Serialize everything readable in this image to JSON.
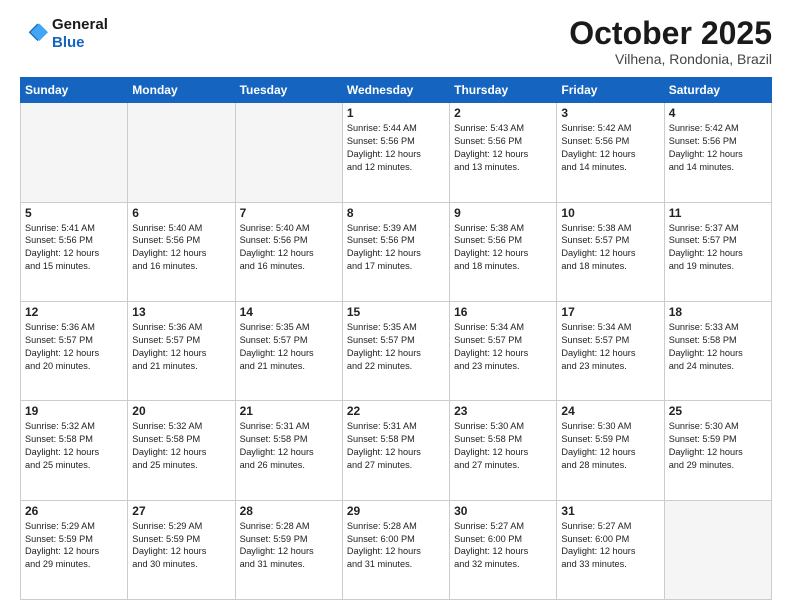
{
  "header": {
    "logo_line1": "General",
    "logo_line2": "Blue",
    "month": "October 2025",
    "location": "Vilhena, Rondonia, Brazil"
  },
  "weekdays": [
    "Sunday",
    "Monday",
    "Tuesday",
    "Wednesday",
    "Thursday",
    "Friday",
    "Saturday"
  ],
  "weeks": [
    [
      {
        "day": "",
        "text": ""
      },
      {
        "day": "",
        "text": ""
      },
      {
        "day": "",
        "text": ""
      },
      {
        "day": "1",
        "text": "Sunrise: 5:44 AM\nSunset: 5:56 PM\nDaylight: 12 hours\nand 12 minutes."
      },
      {
        "day": "2",
        "text": "Sunrise: 5:43 AM\nSunset: 5:56 PM\nDaylight: 12 hours\nand 13 minutes."
      },
      {
        "day": "3",
        "text": "Sunrise: 5:42 AM\nSunset: 5:56 PM\nDaylight: 12 hours\nand 14 minutes."
      },
      {
        "day": "4",
        "text": "Sunrise: 5:42 AM\nSunset: 5:56 PM\nDaylight: 12 hours\nand 14 minutes."
      }
    ],
    [
      {
        "day": "5",
        "text": "Sunrise: 5:41 AM\nSunset: 5:56 PM\nDaylight: 12 hours\nand 15 minutes."
      },
      {
        "day": "6",
        "text": "Sunrise: 5:40 AM\nSunset: 5:56 PM\nDaylight: 12 hours\nand 16 minutes."
      },
      {
        "day": "7",
        "text": "Sunrise: 5:40 AM\nSunset: 5:56 PM\nDaylight: 12 hours\nand 16 minutes."
      },
      {
        "day": "8",
        "text": "Sunrise: 5:39 AM\nSunset: 5:56 PM\nDaylight: 12 hours\nand 17 minutes."
      },
      {
        "day": "9",
        "text": "Sunrise: 5:38 AM\nSunset: 5:56 PM\nDaylight: 12 hours\nand 18 minutes."
      },
      {
        "day": "10",
        "text": "Sunrise: 5:38 AM\nSunset: 5:57 PM\nDaylight: 12 hours\nand 18 minutes."
      },
      {
        "day": "11",
        "text": "Sunrise: 5:37 AM\nSunset: 5:57 PM\nDaylight: 12 hours\nand 19 minutes."
      }
    ],
    [
      {
        "day": "12",
        "text": "Sunrise: 5:36 AM\nSunset: 5:57 PM\nDaylight: 12 hours\nand 20 minutes."
      },
      {
        "day": "13",
        "text": "Sunrise: 5:36 AM\nSunset: 5:57 PM\nDaylight: 12 hours\nand 21 minutes."
      },
      {
        "day": "14",
        "text": "Sunrise: 5:35 AM\nSunset: 5:57 PM\nDaylight: 12 hours\nand 21 minutes."
      },
      {
        "day": "15",
        "text": "Sunrise: 5:35 AM\nSunset: 5:57 PM\nDaylight: 12 hours\nand 22 minutes."
      },
      {
        "day": "16",
        "text": "Sunrise: 5:34 AM\nSunset: 5:57 PM\nDaylight: 12 hours\nand 23 minutes."
      },
      {
        "day": "17",
        "text": "Sunrise: 5:34 AM\nSunset: 5:57 PM\nDaylight: 12 hours\nand 23 minutes."
      },
      {
        "day": "18",
        "text": "Sunrise: 5:33 AM\nSunset: 5:58 PM\nDaylight: 12 hours\nand 24 minutes."
      }
    ],
    [
      {
        "day": "19",
        "text": "Sunrise: 5:32 AM\nSunset: 5:58 PM\nDaylight: 12 hours\nand 25 minutes."
      },
      {
        "day": "20",
        "text": "Sunrise: 5:32 AM\nSunset: 5:58 PM\nDaylight: 12 hours\nand 25 minutes."
      },
      {
        "day": "21",
        "text": "Sunrise: 5:31 AM\nSunset: 5:58 PM\nDaylight: 12 hours\nand 26 minutes."
      },
      {
        "day": "22",
        "text": "Sunrise: 5:31 AM\nSunset: 5:58 PM\nDaylight: 12 hours\nand 27 minutes."
      },
      {
        "day": "23",
        "text": "Sunrise: 5:30 AM\nSunset: 5:58 PM\nDaylight: 12 hours\nand 27 minutes."
      },
      {
        "day": "24",
        "text": "Sunrise: 5:30 AM\nSunset: 5:59 PM\nDaylight: 12 hours\nand 28 minutes."
      },
      {
        "day": "25",
        "text": "Sunrise: 5:30 AM\nSunset: 5:59 PM\nDaylight: 12 hours\nand 29 minutes."
      }
    ],
    [
      {
        "day": "26",
        "text": "Sunrise: 5:29 AM\nSunset: 5:59 PM\nDaylight: 12 hours\nand 29 minutes."
      },
      {
        "day": "27",
        "text": "Sunrise: 5:29 AM\nSunset: 5:59 PM\nDaylight: 12 hours\nand 30 minutes."
      },
      {
        "day": "28",
        "text": "Sunrise: 5:28 AM\nSunset: 5:59 PM\nDaylight: 12 hours\nand 31 minutes."
      },
      {
        "day": "29",
        "text": "Sunrise: 5:28 AM\nSunset: 6:00 PM\nDaylight: 12 hours\nand 31 minutes."
      },
      {
        "day": "30",
        "text": "Sunrise: 5:27 AM\nSunset: 6:00 PM\nDaylight: 12 hours\nand 32 minutes."
      },
      {
        "day": "31",
        "text": "Sunrise: 5:27 AM\nSunset: 6:00 PM\nDaylight: 12 hours\nand 33 minutes."
      },
      {
        "day": "",
        "text": ""
      }
    ]
  ]
}
